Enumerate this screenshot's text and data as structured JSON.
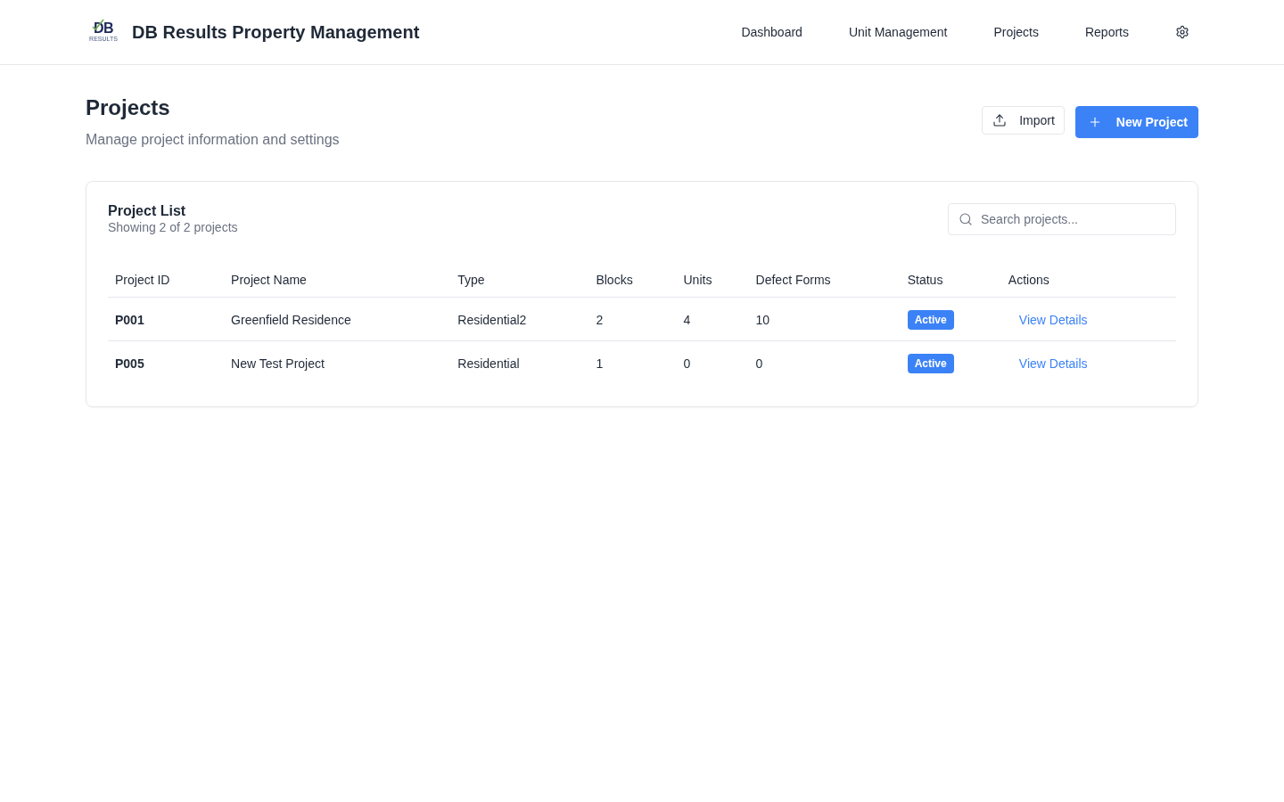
{
  "header": {
    "logo": {
      "mark": "DB",
      "tagline": "RESULTS"
    },
    "title": "DB Results Property Management",
    "nav": [
      "Dashboard",
      "Unit Management",
      "Projects",
      "Reports"
    ]
  },
  "page": {
    "title": "Projects",
    "subtitle": "Manage project information and settings",
    "actions": [
      {
        "label": "Import",
        "kind": "secondary"
      },
      {
        "label": "New Project",
        "kind": "primary"
      }
    ]
  },
  "project_list": {
    "title": "Project List",
    "summary": "Showing 2 of 2 projects",
    "search": {
      "placeholder": "Search projects..."
    },
    "table": {
      "columns": [
        "Project ID",
        "Project Name",
        "Type",
        "Blocks",
        "Units",
        "Defect Forms",
        "Status",
        "Actions"
      ],
      "rows": [
        {
          "project_id": "P001",
          "project_name": "Greenfield Residence",
          "type": "Residential2",
          "blocks": "2",
          "units": "4",
          "defect_forms": "10",
          "status": "Active",
          "action": "View Details"
        },
        {
          "project_id": "P005",
          "project_name": "New Test Project",
          "type": "Residential",
          "blocks": "1",
          "units": "0",
          "defect_forms": "0",
          "status": "Active",
          "action": "View Details"
        }
      ]
    }
  }
}
